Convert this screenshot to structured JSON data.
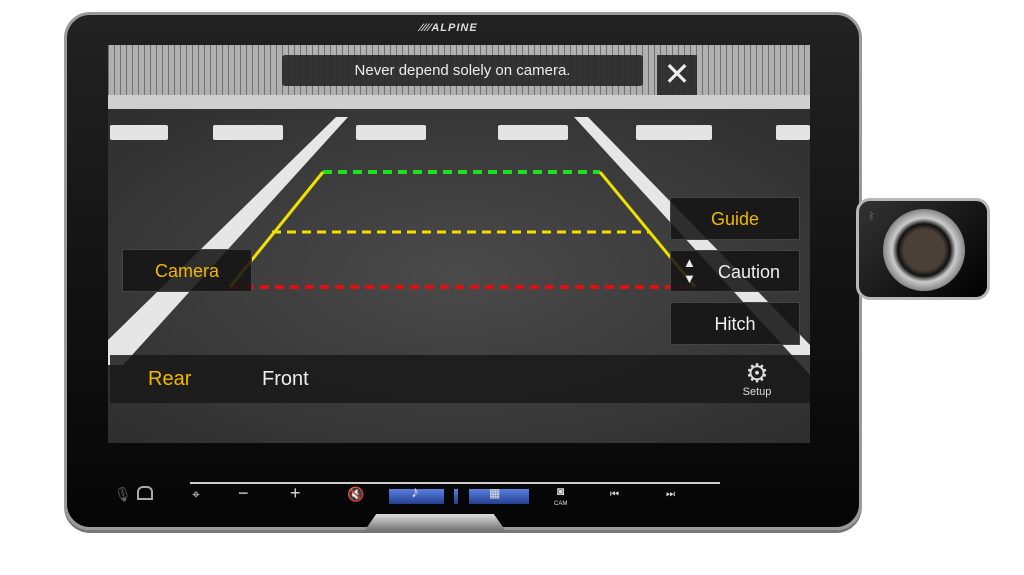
{
  "device": {
    "brand": "ALPINE"
  },
  "notice": {
    "text": "Never depend solely on camera.",
    "close_icon": "close-icon"
  },
  "camera_button": "Camera",
  "side_buttons": {
    "guide": "Guide",
    "caution": "Caution",
    "hitch": "Hitch"
  },
  "bottom_bar": {
    "rear": "Rear",
    "front": "Front",
    "setup": "Setup"
  },
  "controls": {
    "cam_label": "CAM"
  },
  "colors": {
    "selected": "#f2b800",
    "guide_far": "#1ee01e",
    "guide_mid": "#f0e000",
    "guide_near": "#e01010"
  }
}
